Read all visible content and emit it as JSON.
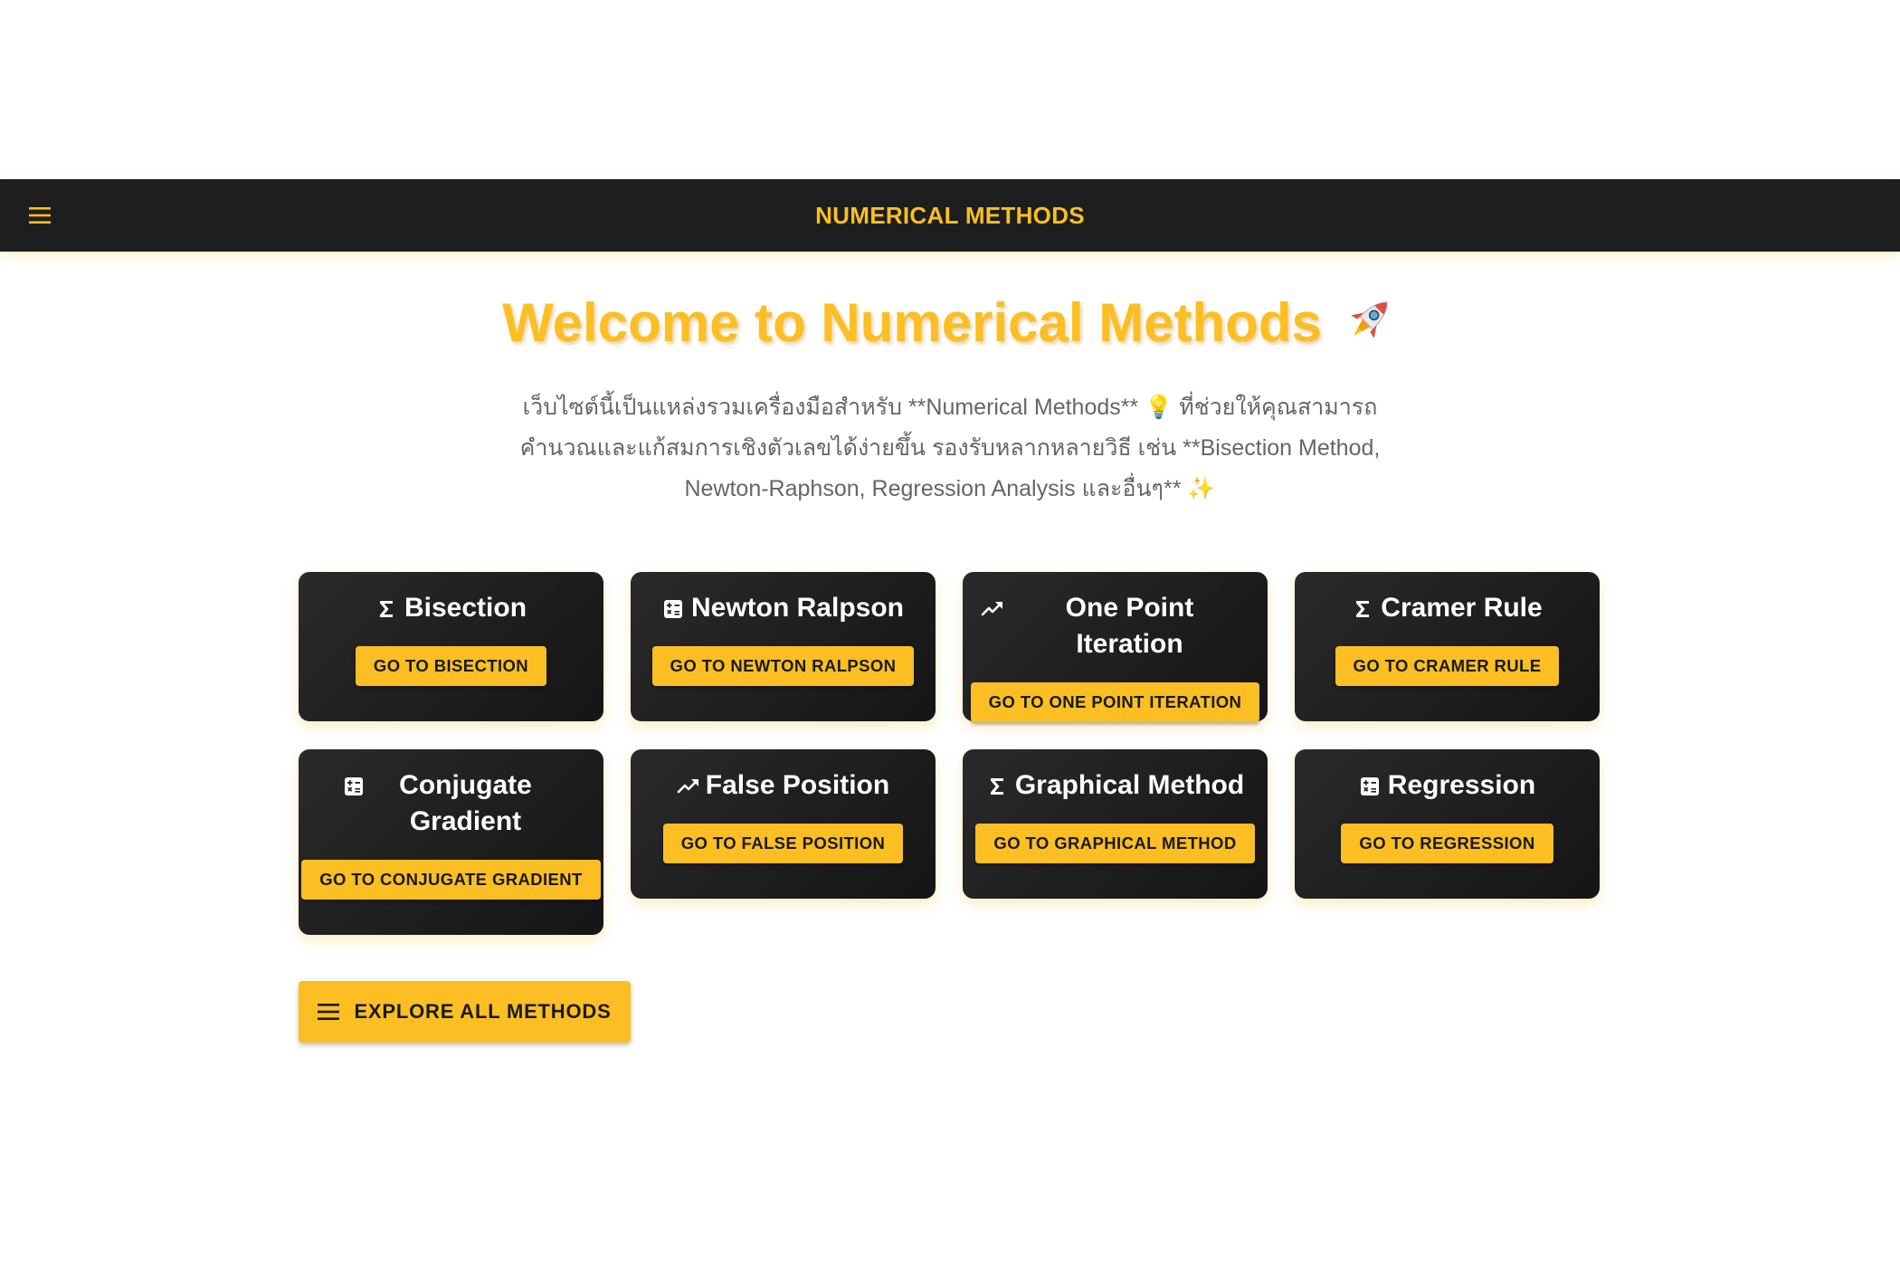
{
  "appbar": {
    "title": "NUMERICAL METHODS",
    "menu_icon": "menu-icon"
  },
  "hero": {
    "title": "Welcome to Numerical Methods",
    "emoji": "🚀",
    "description": "เว็บไซต์นี้เป็นแหล่งรวมเครื่องมือสำหรับ **Numerical Methods** 💡 ที่ช่วยให้คุณสามารถคำนวณและแก้สมการเชิงตัวเลขได้ง่ายขึ้น รองรับหลากหลายวิธี เช่น **Bisection Method, Newton-Raphson, Regression Analysis และอื่นๆ** ✨"
  },
  "cards": [
    {
      "icon": "sigma-icon",
      "title": "Bisection",
      "button": "GO TO BISECTION"
    },
    {
      "icon": "calculator-icon",
      "title": "Newton Ralpson",
      "button": "GO TO NEWTON RALPSON"
    },
    {
      "icon": "trending-up-icon",
      "title": "One Point Iteration",
      "button": "GO TO ONE POINT ITERATION"
    },
    {
      "icon": "sigma-icon",
      "title": "Cramer Rule",
      "button": "GO TO CRAMER RULE"
    },
    {
      "icon": "calculator-icon",
      "title": "Conjugate Gradient",
      "button": "GO TO CONJUGATE GRADIENT"
    },
    {
      "icon": "trending-up-icon",
      "title": "False Position",
      "button": "GO TO FALSE POSITION"
    },
    {
      "icon": "sigma-icon",
      "title": "Graphical Method",
      "button": "GO TO GRAPHICAL METHOD"
    },
    {
      "icon": "calculator-icon",
      "title": "Regression",
      "button": "GO TO REGRESSION"
    }
  ],
  "explore": {
    "label": "EXPLORE ALL METHODS",
    "icon": "menu-icon"
  },
  "colors": {
    "accent": "#fbbf24",
    "appbar_bg": "#1e1e1e",
    "card_bg": "#1f1f1f",
    "desc_text": "#666666"
  }
}
